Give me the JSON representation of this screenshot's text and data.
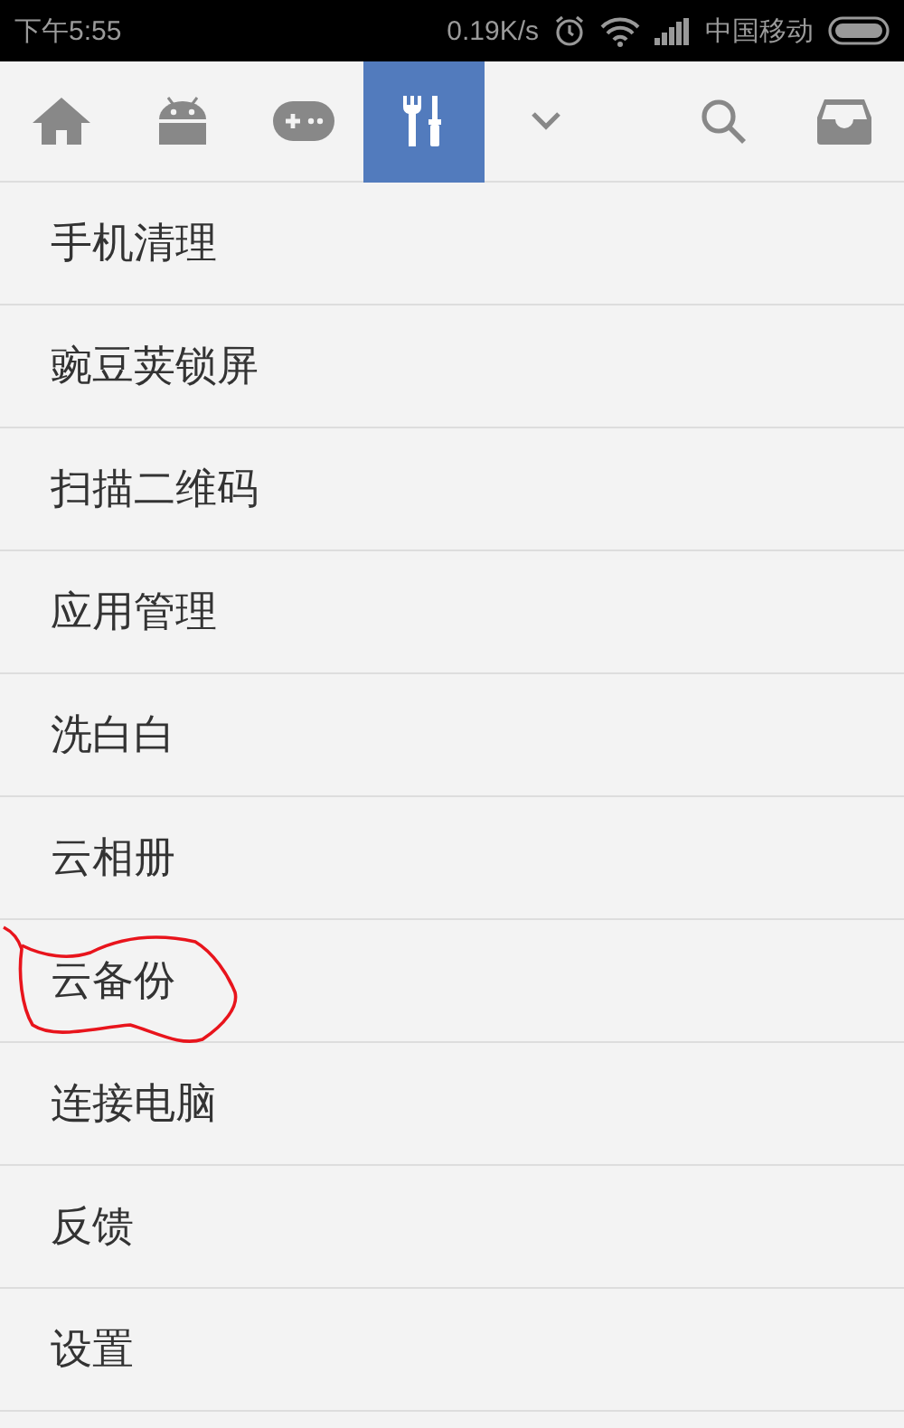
{
  "status_bar": {
    "time": "下午5:55",
    "speed": "0.19K/s",
    "carrier": "中国移动"
  },
  "toolbar": {
    "tabs": [
      {
        "kind": "home",
        "selected": false
      },
      {
        "kind": "android",
        "selected": false
      },
      {
        "kind": "gamepad",
        "selected": false
      },
      {
        "kind": "tools",
        "selected": true
      }
    ],
    "more_button": {
      "kind": "chevron"
    },
    "actions": [
      {
        "kind": "search"
      },
      {
        "kind": "inbox"
      }
    ]
  },
  "menu": {
    "items": [
      {
        "label": "手机清理",
        "circled": false
      },
      {
        "label": "豌豆荚锁屏",
        "circled": false
      },
      {
        "label": "扫描二维码",
        "circled": false
      },
      {
        "label": "应用管理",
        "circled": false
      },
      {
        "label": "洗白白",
        "circled": false
      },
      {
        "label": "云相册",
        "circled": false
      },
      {
        "label": "云备份",
        "circled": true
      },
      {
        "label": "连接电脑",
        "circled": false
      },
      {
        "label": "反馈",
        "circled": false
      },
      {
        "label": "设置",
        "circled": false
      }
    ]
  }
}
